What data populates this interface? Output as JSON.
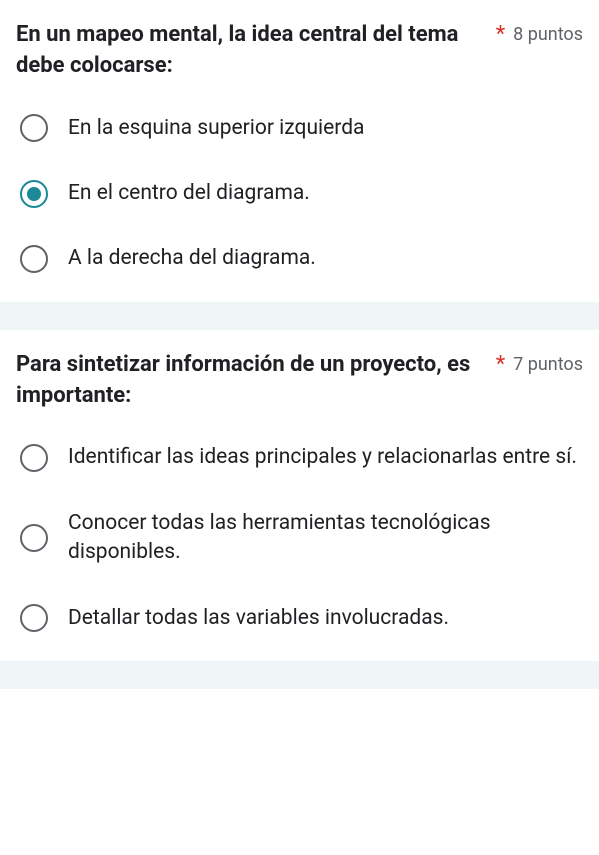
{
  "questions": [
    {
      "title": "En un mapeo mental, la idea central del tema debe colocarse:",
      "points": "8 puntos",
      "options": [
        {
          "label": "En la esquina superior izquierda",
          "selected": false
        },
        {
          "label": "En el centro del diagrama.",
          "selected": true
        },
        {
          "label": "A la derecha del diagrama.",
          "selected": false
        }
      ]
    },
    {
      "title": "Para sintetizar información de un proyecto, es importante:",
      "points": "7 puntos",
      "options": [
        {
          "label": "Identificar las ideas principales y relacionarlas entre sí.",
          "selected": false
        },
        {
          "label": "Conocer todas las herramientas tecnológicas disponibles.",
          "selected": false
        },
        {
          "label": "Detallar todas las variables involucradas.",
          "selected": false
        }
      ]
    }
  ],
  "required_marker": "*"
}
